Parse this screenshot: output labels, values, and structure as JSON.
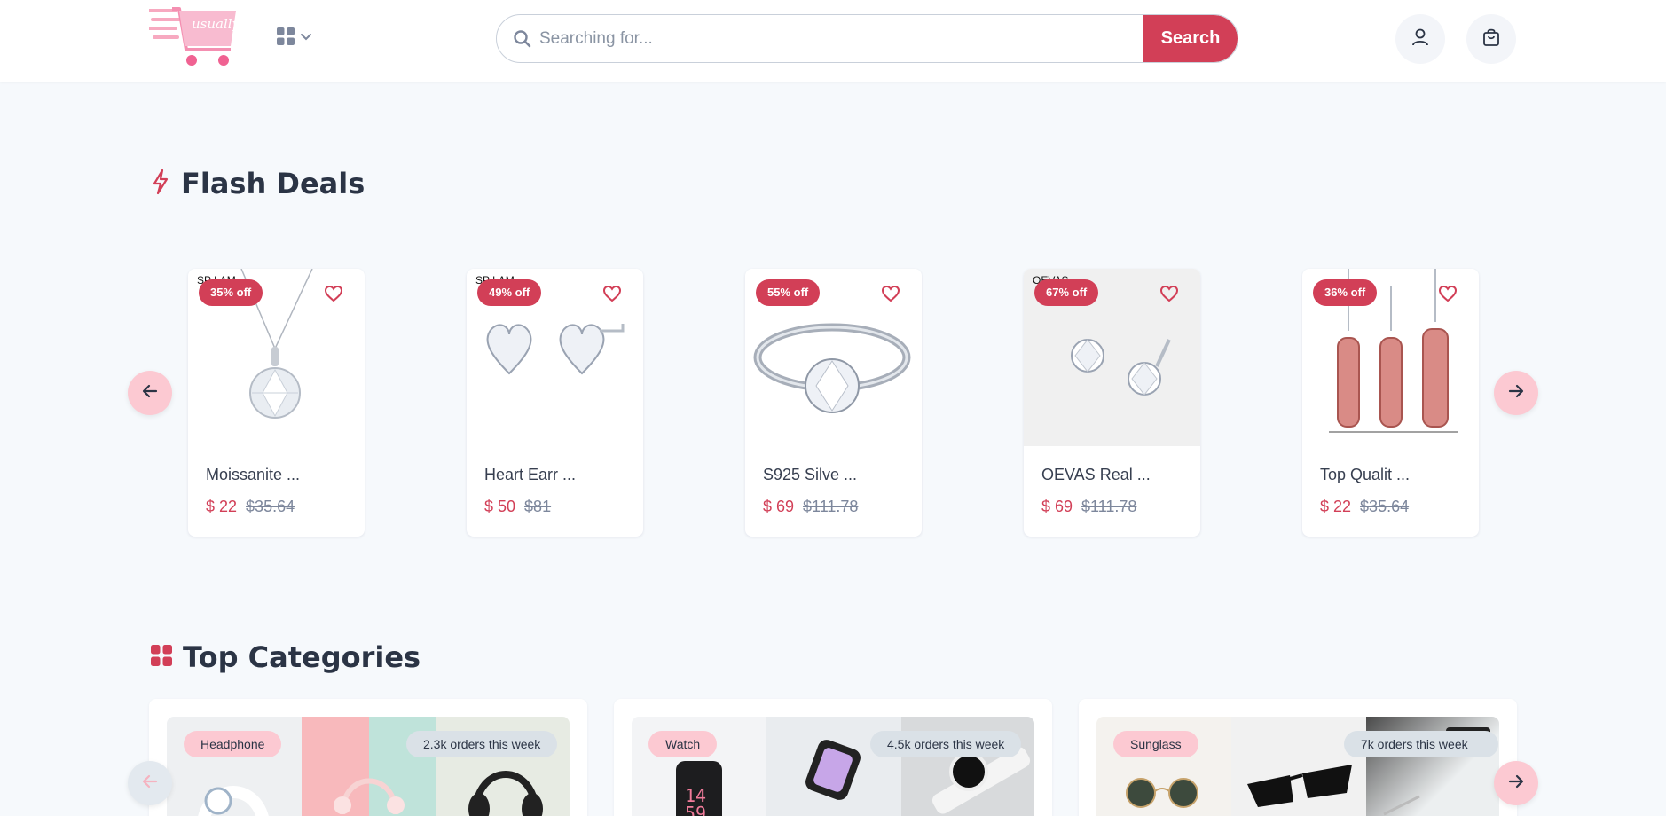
{
  "header": {
    "logo_alt": "usually",
    "search": {
      "placeholder": "Searching for...",
      "button_label": "Search"
    }
  },
  "flash_deals": {
    "title": "Flash Deals",
    "products": [
      {
        "name": "Moissanite ...",
        "discount": "35% off",
        "price": "$ 22",
        "old_price": "$35.64",
        "brand": "SP LAM"
      },
      {
        "name": "Heart Earr ...",
        "discount": "49% off",
        "price": "$ 50",
        "old_price": "$81",
        "brand": "SP LAM"
      },
      {
        "name": "S925 Silve ...",
        "discount": "55% off",
        "price": "$ 69",
        "old_price": "$111.78",
        "brand": ""
      },
      {
        "name": "OEVAS Real ...",
        "discount": "67% off",
        "price": "$ 69",
        "old_price": "$111.78",
        "brand": "OEVAS"
      },
      {
        "name": "Top Qualit ...",
        "discount": "36% off",
        "price": "$ 22",
        "old_price": "$35.64",
        "brand": ""
      }
    ]
  },
  "top_categories": {
    "title": "Top Categories",
    "items": [
      {
        "label": "Headphone",
        "orders": "2.3k orders this week"
      },
      {
        "label": "Watch",
        "orders": "4.5k orders this week"
      },
      {
        "label": "Sunglass",
        "orders": "7k orders this week"
      }
    ]
  },
  "colors": {
    "accent": "#d23f57",
    "accent_light": "#fcc9d2",
    "text": "#2b3445",
    "bg": "#f6f9fc"
  }
}
